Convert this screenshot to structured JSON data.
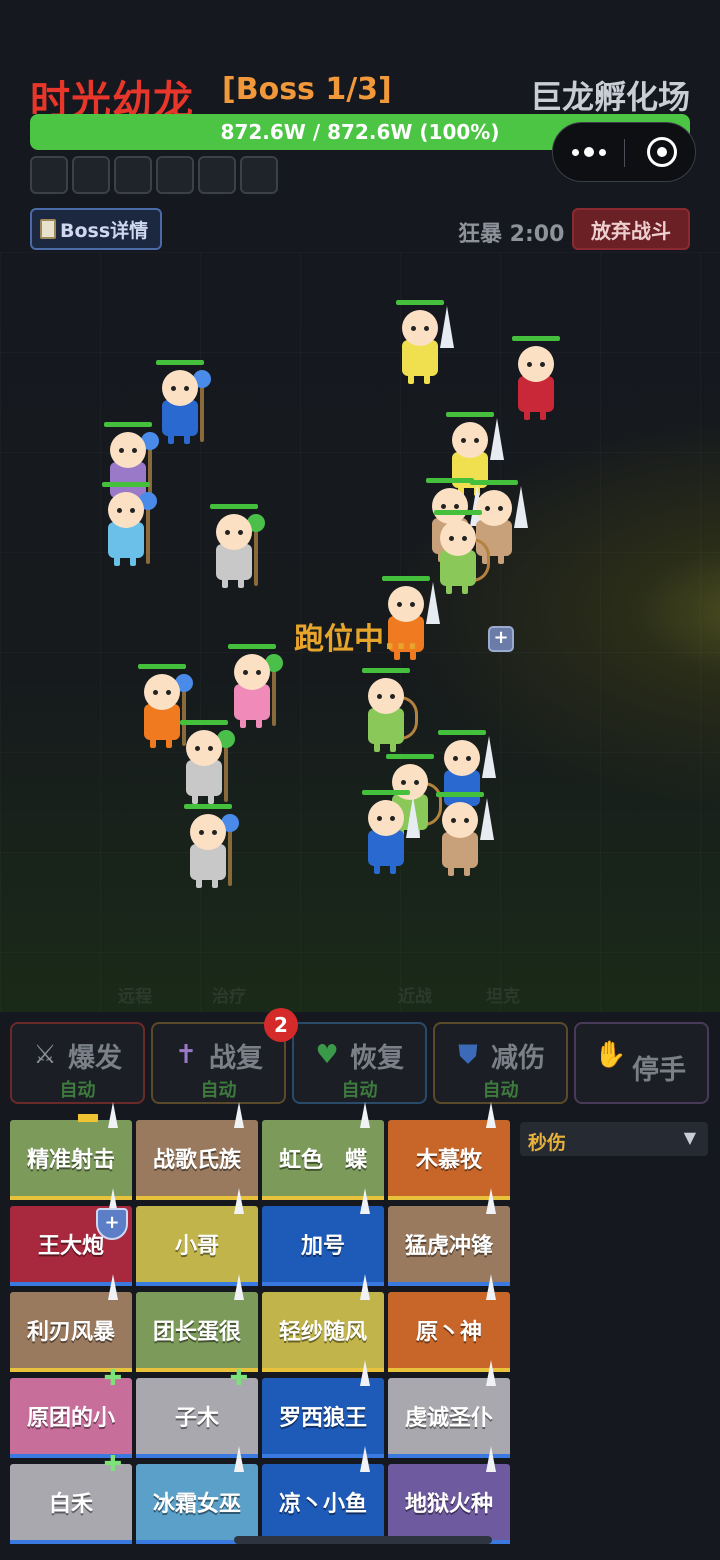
{
  "header": {
    "boss_name": "时光幼龙",
    "boss_stage": "[Boss 1/3]",
    "arena_name": "巨龙孵化场",
    "hp_text": "872.6W / 872.6W (100%)",
    "hp_fraction": 1.0,
    "buff_slots": 6,
    "boss_detail_label": "Boss详情",
    "berserk_label": "狂暴 2:00",
    "give_up_label": "放弃战斗"
  },
  "miniprogram": {
    "more_icon": "more-dots-icon",
    "close_icon": "target-circle-icon"
  },
  "field": {
    "status_text": "跑位中...",
    "zones": [
      "远程",
      "治疗",
      "近战",
      "坦克"
    ]
  },
  "commands": [
    {
      "label": "爆发",
      "sub": "自动",
      "icon": "crossed-swords-icon",
      "border": "#6b2a2a"
    },
    {
      "label": "战复",
      "sub": "自动",
      "icon": "cross-icon",
      "border": "#5a4a2a"
    },
    {
      "label": "恢复",
      "sub": "自动",
      "icon": "heart-icon",
      "border": "#2a4a6a"
    },
    {
      "label": "减伤",
      "sub": "自动",
      "icon": "shield-icon",
      "border": "#5a4a2a"
    },
    {
      "label": "停手",
      "sub": "",
      "icon": "hand-icon",
      "border": "#4a3a5a"
    }
  ],
  "command_badge": "2",
  "sort_select": {
    "value": "秒伤",
    "arrow": "▼"
  },
  "roster": [
    {
      "name": "精准射击",
      "color": "#7c9a5a",
      "bar": "#e8c23a"
    },
    {
      "name": "战歌氏族",
      "color": "#9a7a5e",
      "bar": "#e8c23a"
    },
    {
      "name": "虹色　蝶",
      "color": "#7c9a5a",
      "bar": "#e8c23a"
    },
    {
      "name": "木慕牧",
      "color": "#c8662a",
      "bar": "#e8c23a"
    },
    {
      "name": "王大炮",
      "color": "#a8283e",
      "bar": "#3a7ae0"
    },
    {
      "name": "小哥",
      "color": "#c0b44a",
      "bar": "#3a7ae0"
    },
    {
      "name": "加号",
      "color": "#1e5ab8",
      "bar": "#3a7ae0"
    },
    {
      "name": "猛虎冲锋",
      "color": "#9a7a5e",
      "bar": "#3a7ae0"
    },
    {
      "name": "利刃风暴",
      "color": "#9a7a5e",
      "bar": "#e8c23a"
    },
    {
      "name": "团长蛋很",
      "color": "#7c9a5a",
      "bar": "#e8c23a"
    },
    {
      "name": "轻纱随风",
      "color": "#c0b44a",
      "bar": "#e8c23a"
    },
    {
      "name": "原丶神",
      "color": "#c8662a",
      "bar": "#e8c23a"
    },
    {
      "name": "原团的小",
      "color": "#c86e9a",
      "bar": "#3a7ae0"
    },
    {
      "name": "子木",
      "color": "#a8a8ae",
      "bar": "#3a7ae0"
    },
    {
      "name": "罗西狼王",
      "color": "#1e5ab8",
      "bar": "#3a7ae0"
    },
    {
      "name": "虔诚圣仆",
      "color": "#a8a8ae",
      "bar": "#3a7ae0"
    },
    {
      "name": "白禾",
      "color": "#a8a8ae",
      "bar": "#3a7ae0"
    },
    {
      "name": "冰霜女巫",
      "color": "#5aa0c8",
      "bar": "#3a7ae0"
    },
    {
      "name": "凉丶小鱼",
      "color": "#1e5ab8",
      "bar": "#3a7ae0"
    },
    {
      "name": "地狱火种",
      "color": "#6e5a9e",
      "bar": "#3a7ae0"
    }
  ]
}
